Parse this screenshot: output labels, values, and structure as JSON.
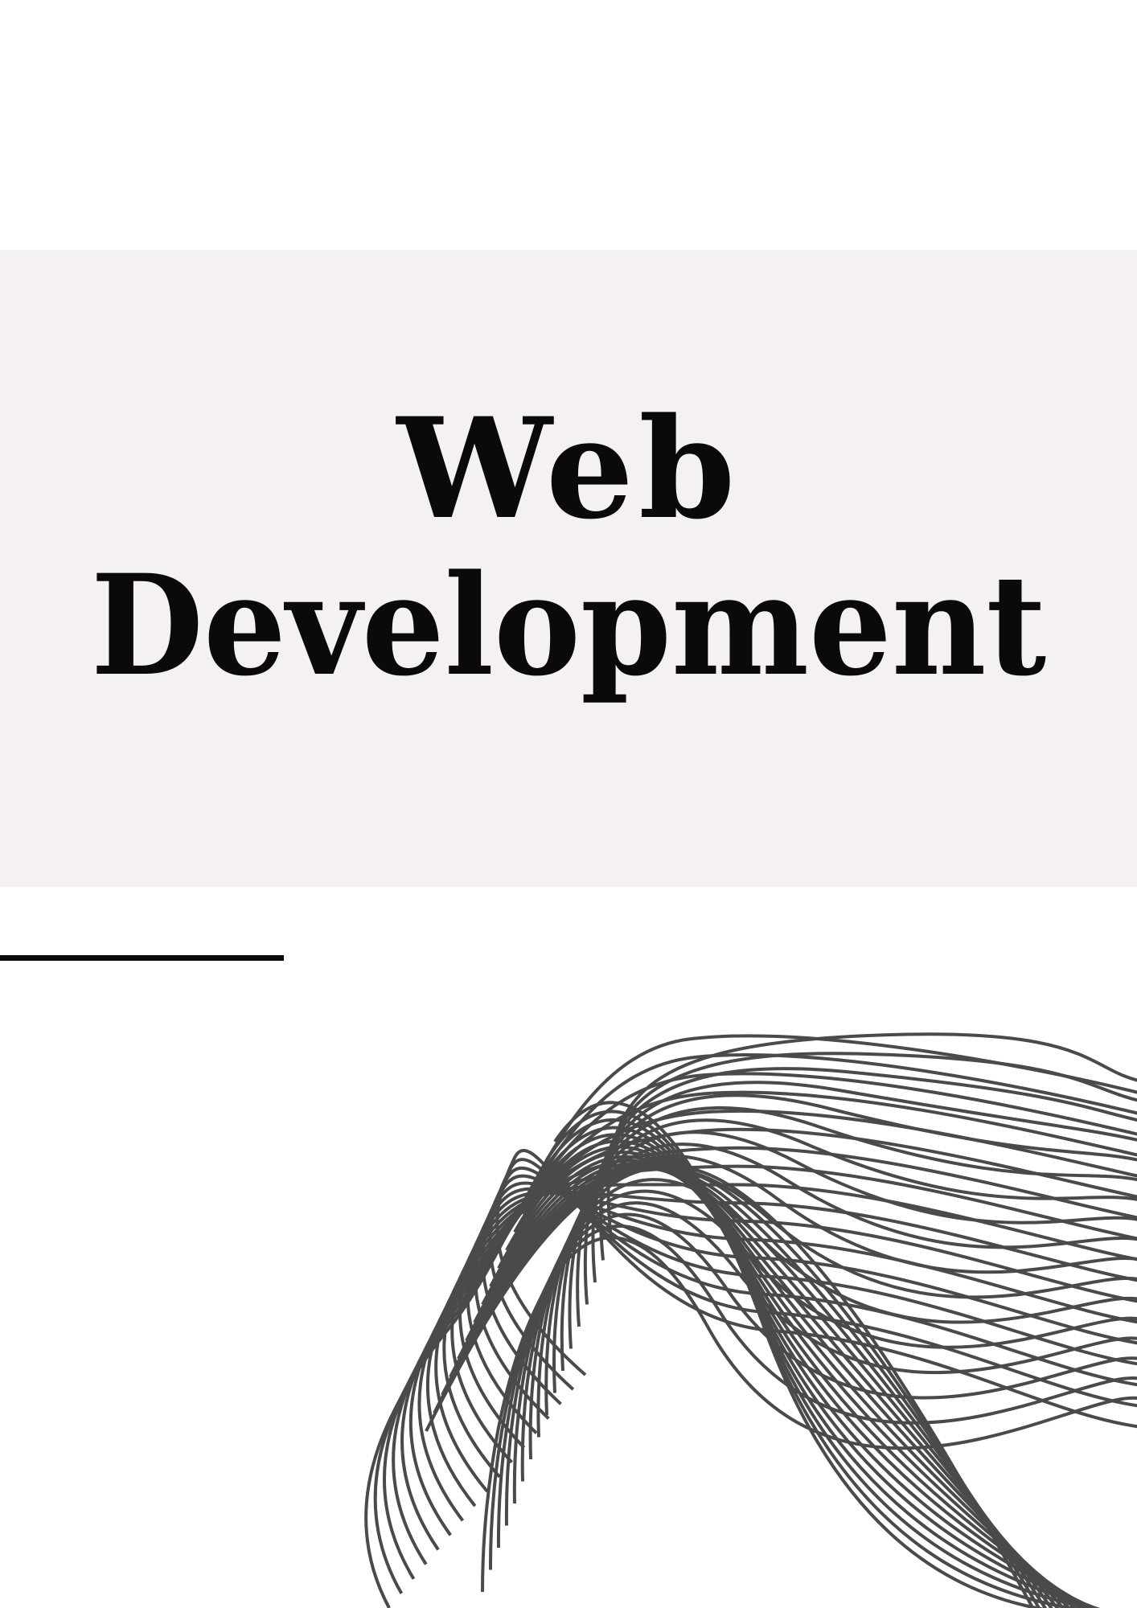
{
  "cover": {
    "title_line_1": "Web",
    "title_line_2": "Development"
  },
  "colors": {
    "band": "#f4f1f0",
    "text": "#0a0a0a",
    "lines": "#4a4a4a"
  },
  "decoration": {
    "line_art": "stacked-wave-lines"
  }
}
